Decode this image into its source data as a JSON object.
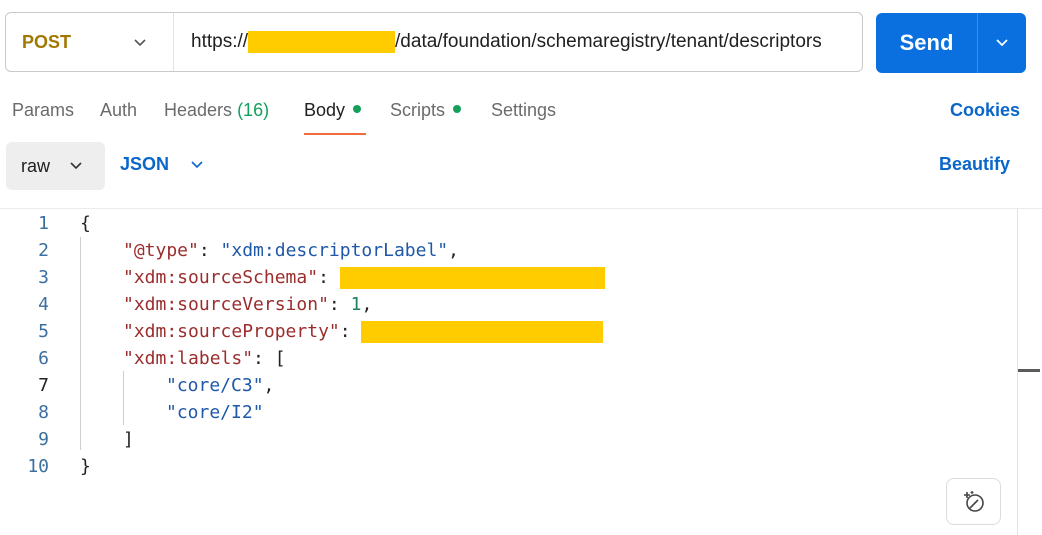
{
  "request": {
    "method": "POST",
    "url_prefix": "https://",
    "url_path": "/data/foundation/schemaregistry/tenant/descriptors"
  },
  "send": {
    "label": "Send"
  },
  "tabs": [
    {
      "label": "Params"
    },
    {
      "label": "Auth"
    },
    {
      "label": "Headers",
      "count": "(16)"
    },
    {
      "label": "Body"
    },
    {
      "label": "Scripts"
    },
    {
      "label": "Settings"
    }
  ],
  "cookies_label": "Cookies",
  "body_mode": {
    "raw_label": "raw",
    "language_label": "JSON",
    "beautify_label": "Beautify"
  },
  "editor": {
    "line_numbers": [
      "1",
      "2",
      "3",
      "4",
      "5",
      "6",
      "7",
      "8",
      "9",
      "10"
    ],
    "lines": {
      "l1": "{",
      "l2_key": "\"@type\"",
      "l2_val": "\"xdm:descriptorLabel\"",
      "l3_key": "\"xdm:sourceSchema\"",
      "l4_key": "\"xdm:sourceVersion\"",
      "l4_val": "1",
      "l5_key": "\"xdm:sourceProperty\"",
      "l6_key": "\"xdm:labels\"",
      "l7_val": "\"core/C3\"",
      "l8_val": "\"core/I2\"",
      "l9": "]",
      "l10": "}"
    }
  },
  "colors": {
    "accent": "#0a70e0",
    "method": "#a17800",
    "redaction": "#ffcc00",
    "tab_underline": "#f26b3a",
    "status_dot": "#14a05a"
  },
  "icons": [
    "chevron-down-icon",
    "magic-sparkle-icon"
  ]
}
